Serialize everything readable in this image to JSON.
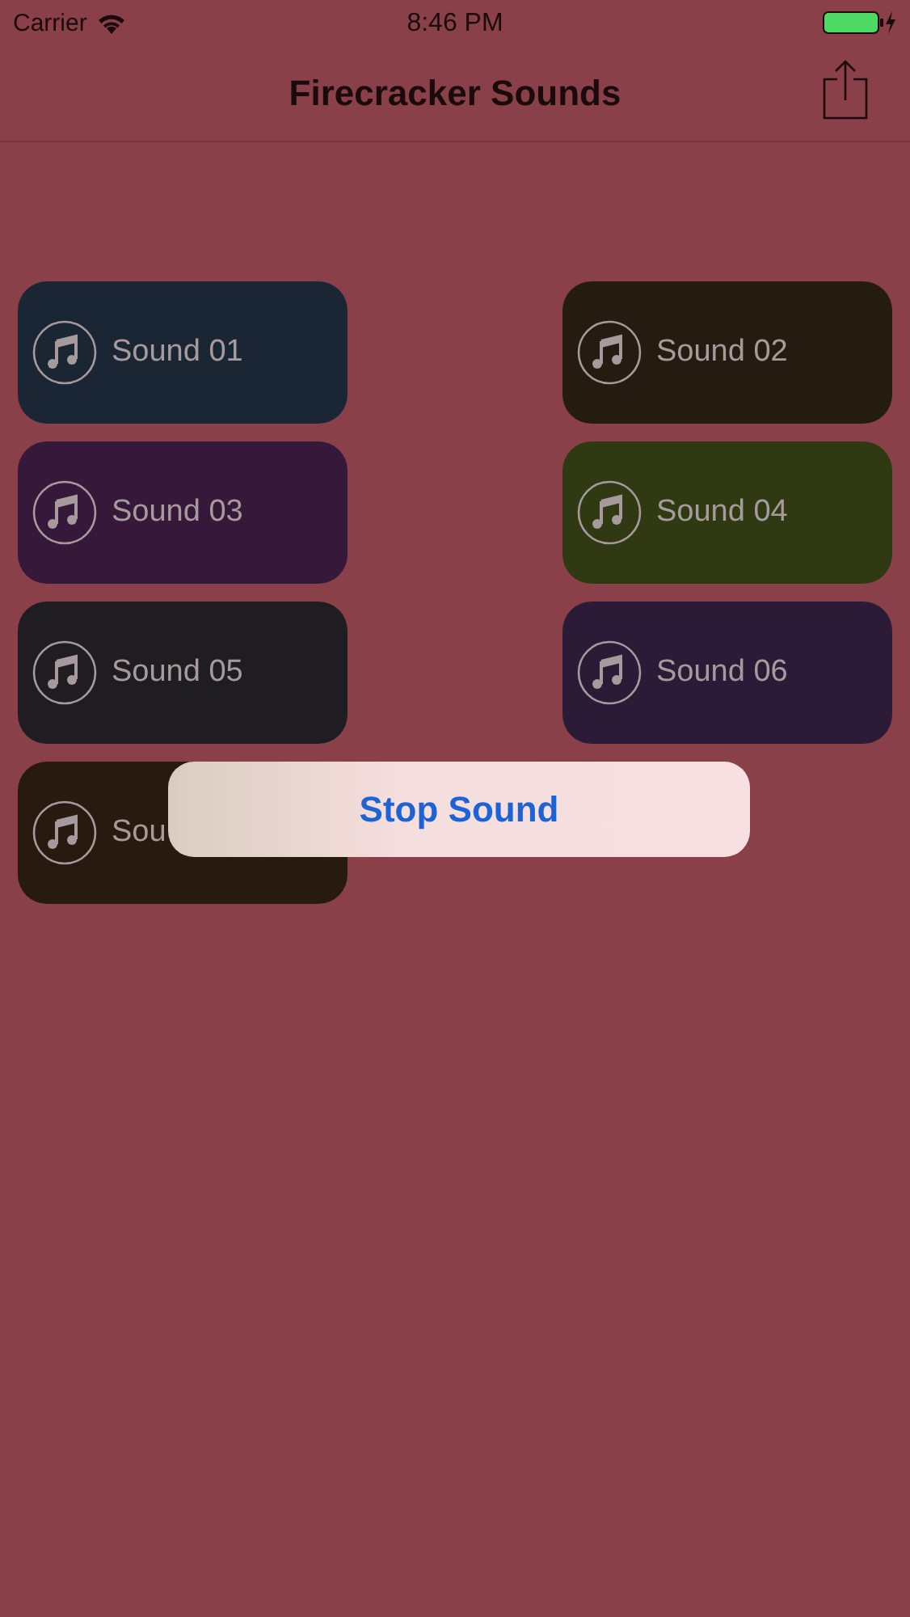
{
  "status_bar": {
    "carrier": "Carrier",
    "time": "8:46 PM"
  },
  "nav_bar": {
    "title": "Firecracker Sounds"
  },
  "sounds": [
    {
      "label": "Sound 01",
      "color": "#1b2634"
    },
    {
      "label": "Sound 02",
      "color": "#241c10"
    },
    {
      "label": "Sound 03",
      "color": "#35183a"
    },
    {
      "label": "Sound 04",
      "color": "#2f3a12"
    },
    {
      "label": "Sound 05",
      "color": "#1f1d22"
    },
    {
      "label": "Sound 06",
      "color": "#2b1b36"
    },
    {
      "label": "Sou",
      "color": "#261b0e"
    }
  ],
  "stop_button": {
    "label": "Stop Sound"
  }
}
